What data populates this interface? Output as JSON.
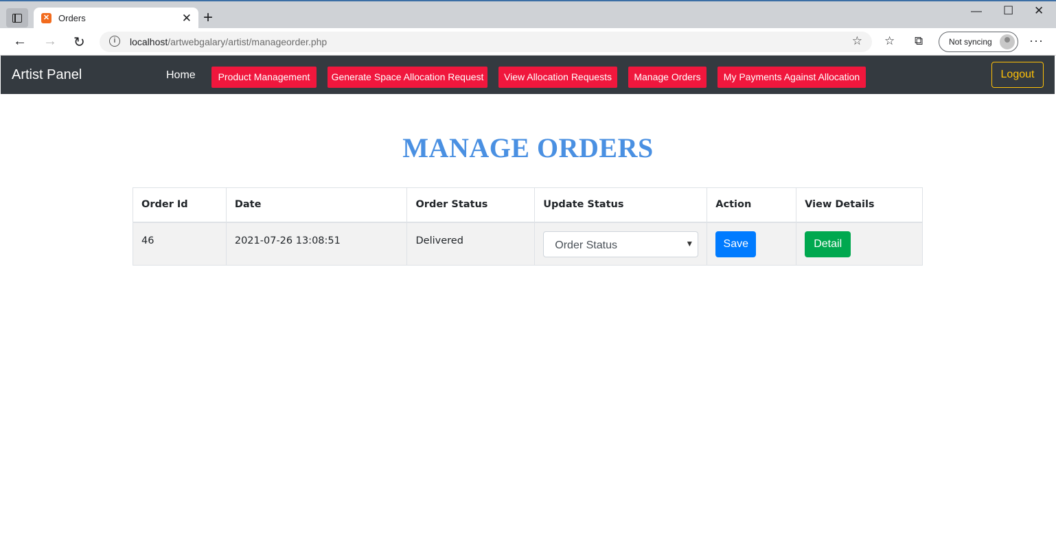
{
  "browser": {
    "tab_title": "Orders",
    "url_host": "localhost",
    "url_path": "/artwebgalary/artist/manageorder.php",
    "sync_label": "Not syncing"
  },
  "navbar": {
    "brand": "Artist Panel",
    "home": "Home",
    "buttons": [
      "Product Management",
      "Generate Space Allocation Request",
      "View Allocation Requests",
      "Manage Orders",
      "My Payments Against Allocation"
    ],
    "logout": "Logout"
  },
  "page": {
    "title": "MANAGE ORDERS"
  },
  "table": {
    "headers": [
      "Order Id",
      "Date",
      "Order Status",
      "Update Status",
      "Action",
      "View Details"
    ],
    "rows": [
      {
        "order_id": "46",
        "date": "2021-07-26 13:08:51",
        "status": "Delivered",
        "select_value": "Order Status",
        "action_label": "Save",
        "details_label": "Detail"
      }
    ]
  },
  "colors": {
    "navbar_bg": "#343a40",
    "nav_button": "#f0173d",
    "logout": "#ffc107",
    "title": "#4a90e2",
    "save": "#007bff",
    "detail": "#00a84f"
  }
}
